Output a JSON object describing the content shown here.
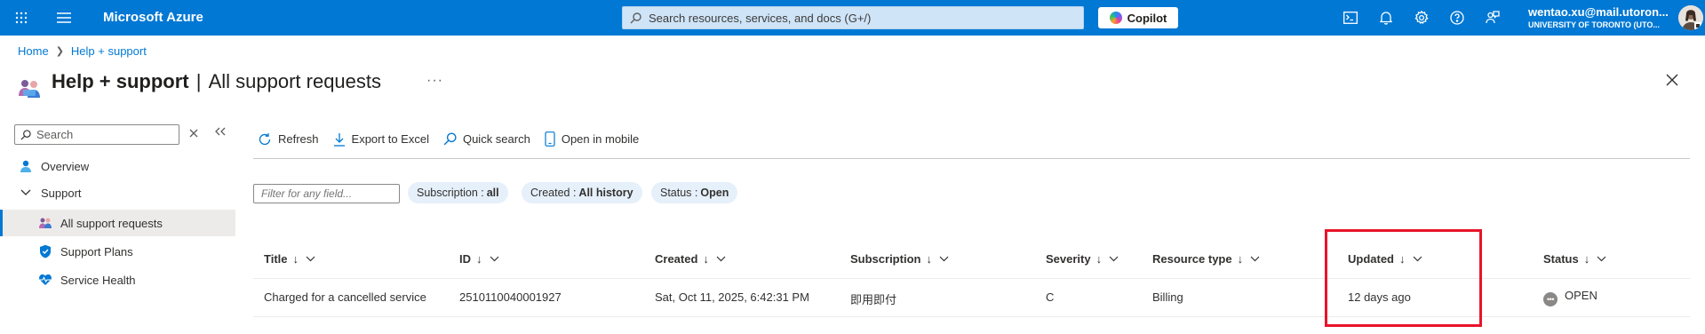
{
  "topbar": {
    "brand": "Microsoft Azure",
    "search_placeholder": "Search resources, services, and docs (G+/)",
    "copilot_label": "Copilot",
    "user_email": "wentao.xu@mail.utoron...",
    "user_org": "UNIVERSITY OF TORONTO (UTO...",
    "icons": [
      "portal-menu-icon",
      "hamburger-icon",
      "cloud-shell-icon",
      "notifications-icon",
      "settings-icon",
      "help-icon",
      "feedback-icon"
    ]
  },
  "breadcrumb": [
    "Home",
    "Help + support"
  ],
  "title": {
    "main": "Help + support",
    "sub": "All support requests"
  },
  "sidebar": {
    "search_placeholder": "Search",
    "items": [
      {
        "label": "Overview",
        "icon": "overview-icon"
      },
      {
        "label": "Support",
        "icon": "chevron-down-icon"
      },
      {
        "label": "All support requests",
        "icon": "support-requests-icon",
        "active": true
      },
      {
        "label": "Support Plans",
        "icon": "shield-icon"
      },
      {
        "label": "Service Health",
        "icon": "heart-icon"
      }
    ]
  },
  "toolbar": {
    "refresh": "Refresh",
    "export": "Export to Excel",
    "quick_search": "Quick search",
    "mobile": "Open in mobile"
  },
  "filters": {
    "placeholder": "Filter for any field...",
    "pills": [
      {
        "key": "Subscription :",
        "value": "all"
      },
      {
        "key": "Created :",
        "value": "All history"
      },
      {
        "key": "Status :",
        "value": "Open"
      }
    ]
  },
  "table": {
    "sort_arrow": "↓",
    "columns": [
      "Title",
      "ID",
      "Created",
      "Subscription",
      "Severity",
      "Resource type",
      "Updated",
      "Status"
    ],
    "rows": [
      {
        "title": "Charged for a cancelled service",
        "id": "2510110040001927",
        "created": "Sat, Oct 11, 2025, 6:42:31 PM",
        "subscription": "即用即付",
        "severity": "C",
        "resource_type": "Billing",
        "updated": "12 days ago",
        "status": "OPEN"
      }
    ]
  },
  "colors": {
    "accent": "#0078d4",
    "highlight": "#e8142a",
    "pill_bg": "#e6f0fa"
  }
}
